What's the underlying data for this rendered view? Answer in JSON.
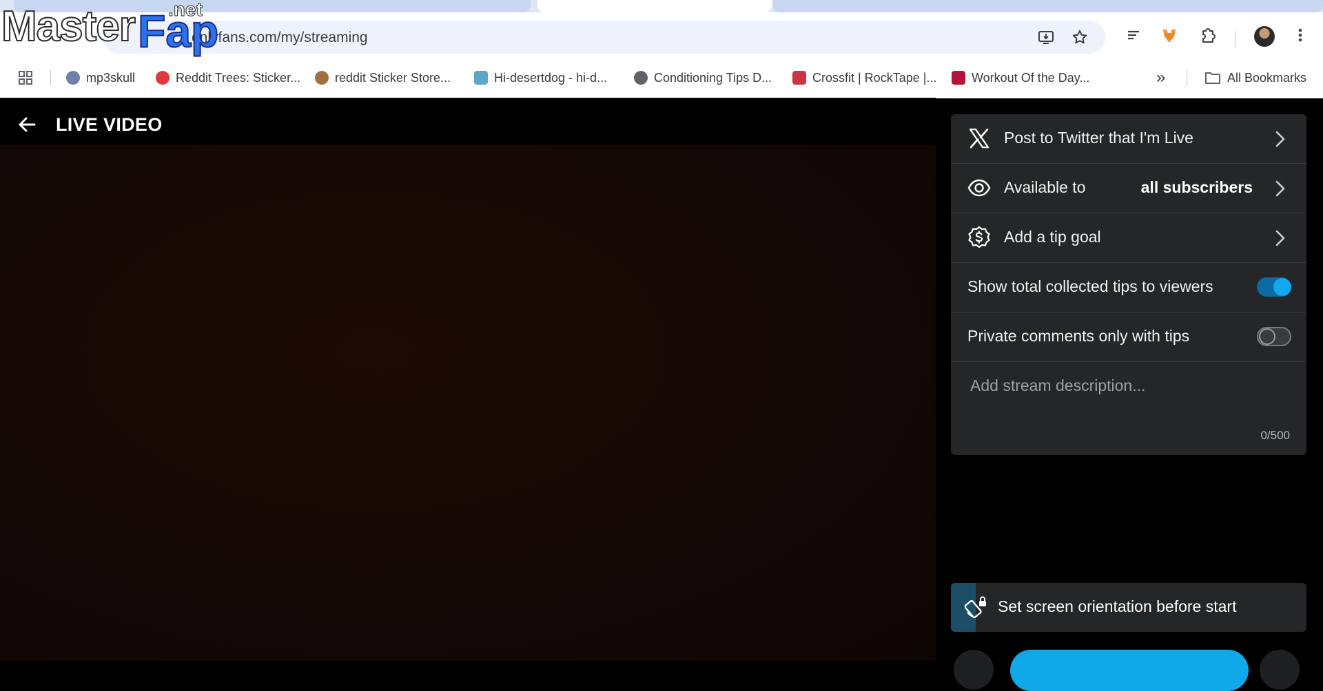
{
  "browser": {
    "url": "onlyfans.com/my/streaming",
    "bookmarks": [
      {
        "label": "mp3skull",
        "color": "#6e7fa8"
      },
      {
        "label": "Reddit Trees: Sticker...",
        "color": "#e0383f"
      },
      {
        "label": "reddit Sticker Store...",
        "color": "#a07040"
      },
      {
        "label": "Hi-desertdog - hi-d...",
        "color": "#5aa7c9"
      },
      {
        "label": "Conditioning Tips D...",
        "color": "#5f6368"
      },
      {
        "label": "Crossfit | RockTape |...",
        "color": "#cc3344"
      },
      {
        "label": "Workout Of the Day...",
        "color": "#b3123a"
      }
    ],
    "all_bookmarks_label": "All Bookmarks",
    "more_bookmarks_label": "»"
  },
  "watermark": {
    "part1": "Master",
    "part2": "Fap",
    "part3": ".net"
  },
  "page": {
    "title": "LIVE VIDEO"
  },
  "settings": {
    "twitter_label": "Post to Twitter that I'm Live",
    "available_label": "Available to",
    "available_value": "all subscribers",
    "tip_goal_label": "Add a tip goal",
    "show_tips_label": "Show total collected tips to viewers",
    "show_tips_on": true,
    "private_comments_label": "Private comments only with tips",
    "private_comments_on": false,
    "description_placeholder": "Add stream description...",
    "char_counter": "0/500"
  },
  "orientation": {
    "label": "Set screen orientation before start"
  },
  "colors": {
    "accent": "#11a8e8",
    "panel_bg": "#252628"
  }
}
